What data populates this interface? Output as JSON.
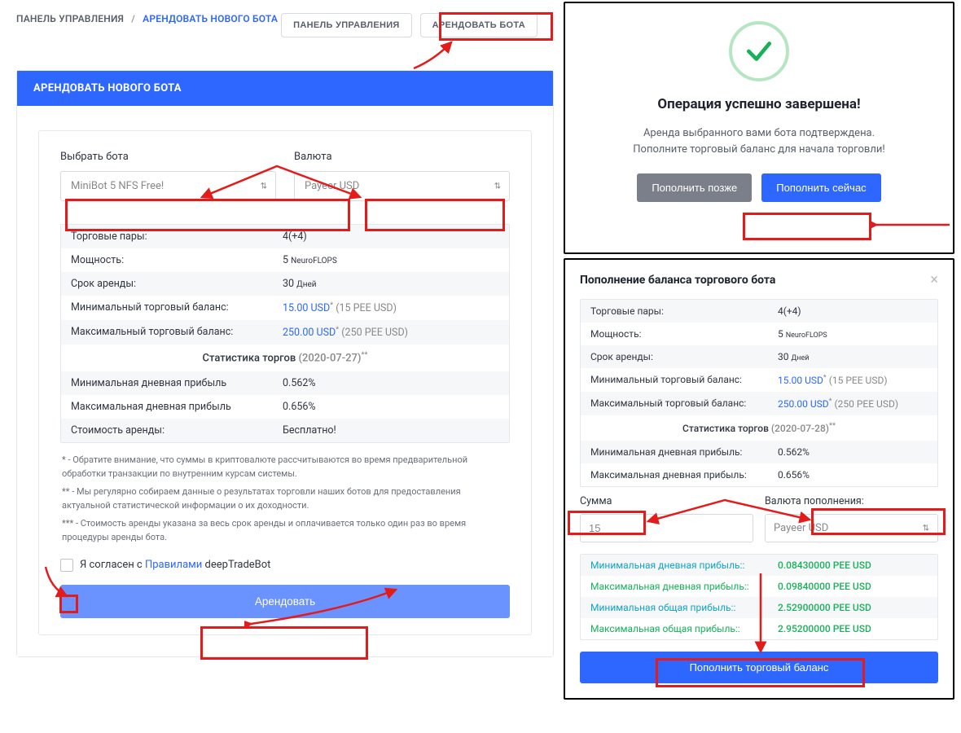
{
  "breadcrumb": {
    "root": "ПАНЕЛЬ УПРАВЛЕНИЯ",
    "current": "АРЕНДОВАТЬ НОВОГО БОТА",
    "sep": "/"
  },
  "top_buttons": {
    "panel": "ПАНЕЛЬ УПРАВЛЕНИЯ",
    "rent": "АРЕНДОВАТЬ БОТА"
  },
  "rent_card": {
    "title": "АРЕНДОВАТЬ НОВОГО БОТА",
    "field_bot_label": "Выбрать бота",
    "field_bot_value": "MiniBot 5 NFS Free!",
    "field_currency_label": "Валюта",
    "field_currency_value": "Payeer USD",
    "info": {
      "pairs_k": "Торговые пары:",
      "pairs_v": "4(+4)",
      "power_k": "Мощность:",
      "power_v_num": "5",
      "power_v_unit": "NeuroFLOPS",
      "term_k": "Срок аренды:",
      "term_v_num": "30",
      "term_v_unit": "Дней",
      "minbal_k": "Минимальный торговый баланс:",
      "minbal_v": "15.00 USD",
      "minbal_v2": "(15 PEE USD)",
      "maxbal_k": "Максимальный торговый баланс:",
      "maxbal_v": "250.00 USD",
      "maxbal_v2": "(250 PEE USD)",
      "stats_label": "Статистика торгов",
      "stats_date": "(2020-07-27)",
      "min_daily_k": "Минимальная дневная прибыль",
      "min_daily_v": "0.562%",
      "max_daily_k": "Максимальная дневная прибыль",
      "max_daily_v": "0.656%",
      "cost_k": "Стоимость аренды:",
      "cost_v": "Бесплатно!"
    },
    "notes": {
      "n1": "* - Обратите внимание, что суммы в криптовалюте рассчитываются во время предварительной обработки транзакции по внутренним курсам системы.",
      "n2": "** - Мы регулярно собираем данные о результатах торговли наших ботов для предоставления актуальной статистической информации о их доходности.",
      "n3": "*** - Стоимость аренды указана за весь срок аренды и оплачивается только один раз во время процедуры аренды бота."
    },
    "agree_prefix": "Я согласен с ",
    "agree_link": "Правилами",
    "agree_suffix": " deepTradeBot",
    "rent_button": "Арендовать"
  },
  "modal_success": {
    "title": "Операция успешно завершена!",
    "line1": "Аренда выбранного вами бота подтверждена.",
    "line2": "Пополните торговый баланс для начала торговли!",
    "btn_later": "Пополнить позже",
    "btn_now": "Пополнить сейчас"
  },
  "modal_topup": {
    "title": "Пополнение баланса торгового бота",
    "info": {
      "pairs_k": "Торговые пары:",
      "pairs_v": "4(+4)",
      "power_k": "Мощность:",
      "power_v_num": "5",
      "power_v_unit": "NeuroFLOPS",
      "term_k": "Срок аренды:",
      "term_v_num": "30",
      "term_v_unit": "Дней",
      "minbal_k": "Минимальный торговый баланс:",
      "minbal_v": "15.00 USD",
      "minbal_v2": "(15 PEE USD)",
      "maxbal_k": "Максимальный торговый баланс:",
      "maxbal_v": "250.00 USD",
      "maxbal_v2": "(250 PEE USD)",
      "stats_label": "Статистика торгов",
      "stats_date": "(2020-07-28)",
      "min_daily_k": "Минимальная дневная прибыль:",
      "min_daily_v": "0.562%",
      "max_daily_k": "Максимальная дневная прибыль:",
      "max_daily_v": "0.656%"
    },
    "sum_label": "Сумма",
    "sum_value": "15",
    "curr_label": "Валюта пополнения:",
    "curr_value": "Payeer USD",
    "profit": {
      "min_daily_k": "Минимальная дневная прибыль::",
      "min_daily_v": "0.08430000 PEE USD",
      "max_daily_k": "Максимальная дневная прибыль::",
      "max_daily_v": "0.09840000 PEE USD",
      "min_total_k": "Минимальная общая прибыль::",
      "min_total_v": "2.52900000 PEE USD",
      "max_total_k": "Максимальная общая прибыль::",
      "max_total_v": "2.95200000 PEE USD"
    },
    "btn_topup": "Пополнить торговый баланс"
  }
}
